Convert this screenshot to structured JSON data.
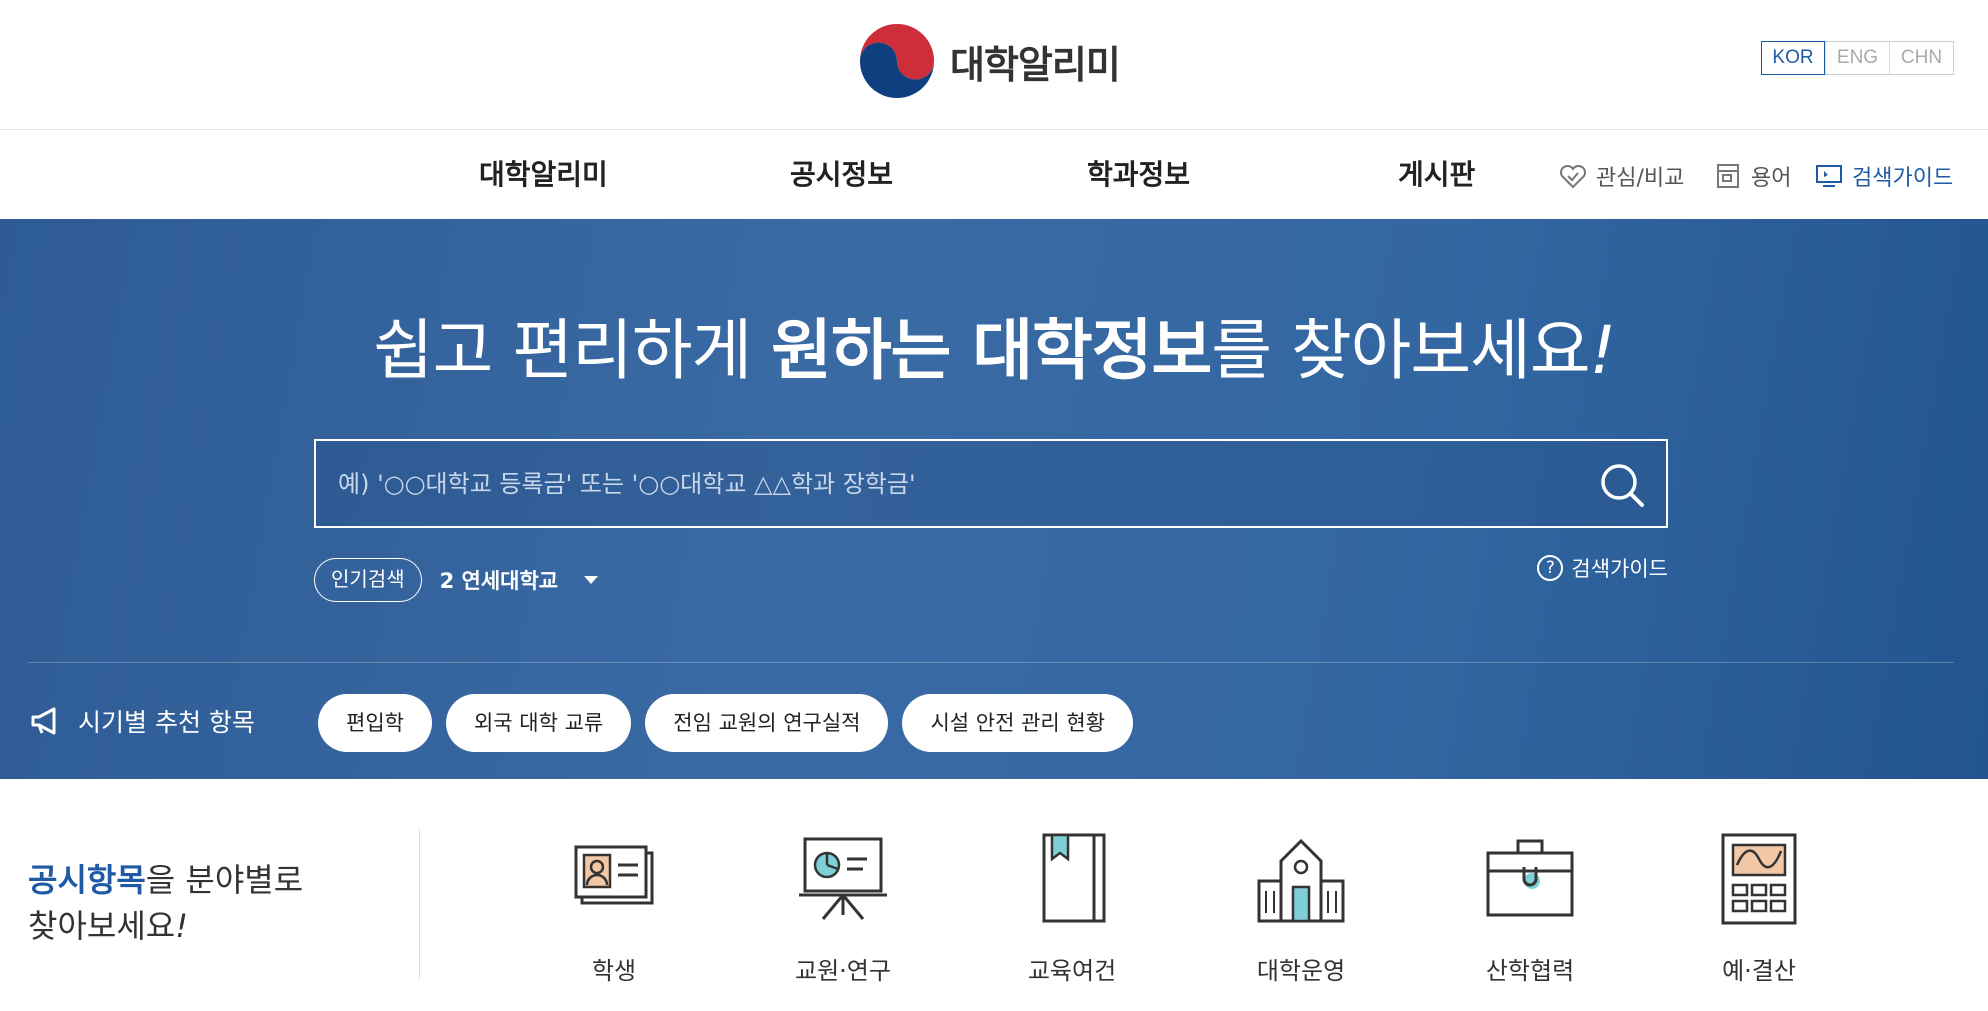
{
  "header": {
    "logo_text": "대학알리미",
    "languages": [
      "KOR",
      "ENG",
      "CHN"
    ]
  },
  "nav": {
    "items": [
      "대학알리미",
      "공시정보",
      "학과정보",
      "게시판"
    ],
    "utilities": {
      "favorite": "관심/비교",
      "glossary": "용어",
      "search_guide": "검색가이드"
    }
  },
  "hero": {
    "title_part1": "쉽고 편리하게 ",
    "title_bold": "원하는 대학정보",
    "title_part2": "를 찾아보세요",
    "title_exclaim": "!",
    "search_placeholder": "예) '○○대학교 등록금' 또는 '○○대학교 △△학과 장학금'",
    "popular_label": "인기검색",
    "popular_value": "2 연세대학교",
    "guide_link": "검색가이드",
    "recommend_label": "시기별 추천 항목",
    "recommend_items": [
      "편입학",
      "외국 대학 교류",
      "전임 교원의 연구실적",
      "시설 안전 관리 현황"
    ]
  },
  "categories": {
    "heading_strong": "공시항목",
    "heading_line1_rest": "을 분야별로",
    "heading_line2": "찾아보세요",
    "heading_exclaim": "!",
    "items": [
      "학생",
      "교원·연구",
      "교육여건",
      "대학운영",
      "산학협력",
      "예·결산"
    ]
  },
  "colors": {
    "accent": "#1f5aa6",
    "hero_bg": "#3367a2",
    "icon_stroke": "#333333",
    "icon_accent": "#7fd0d6"
  }
}
